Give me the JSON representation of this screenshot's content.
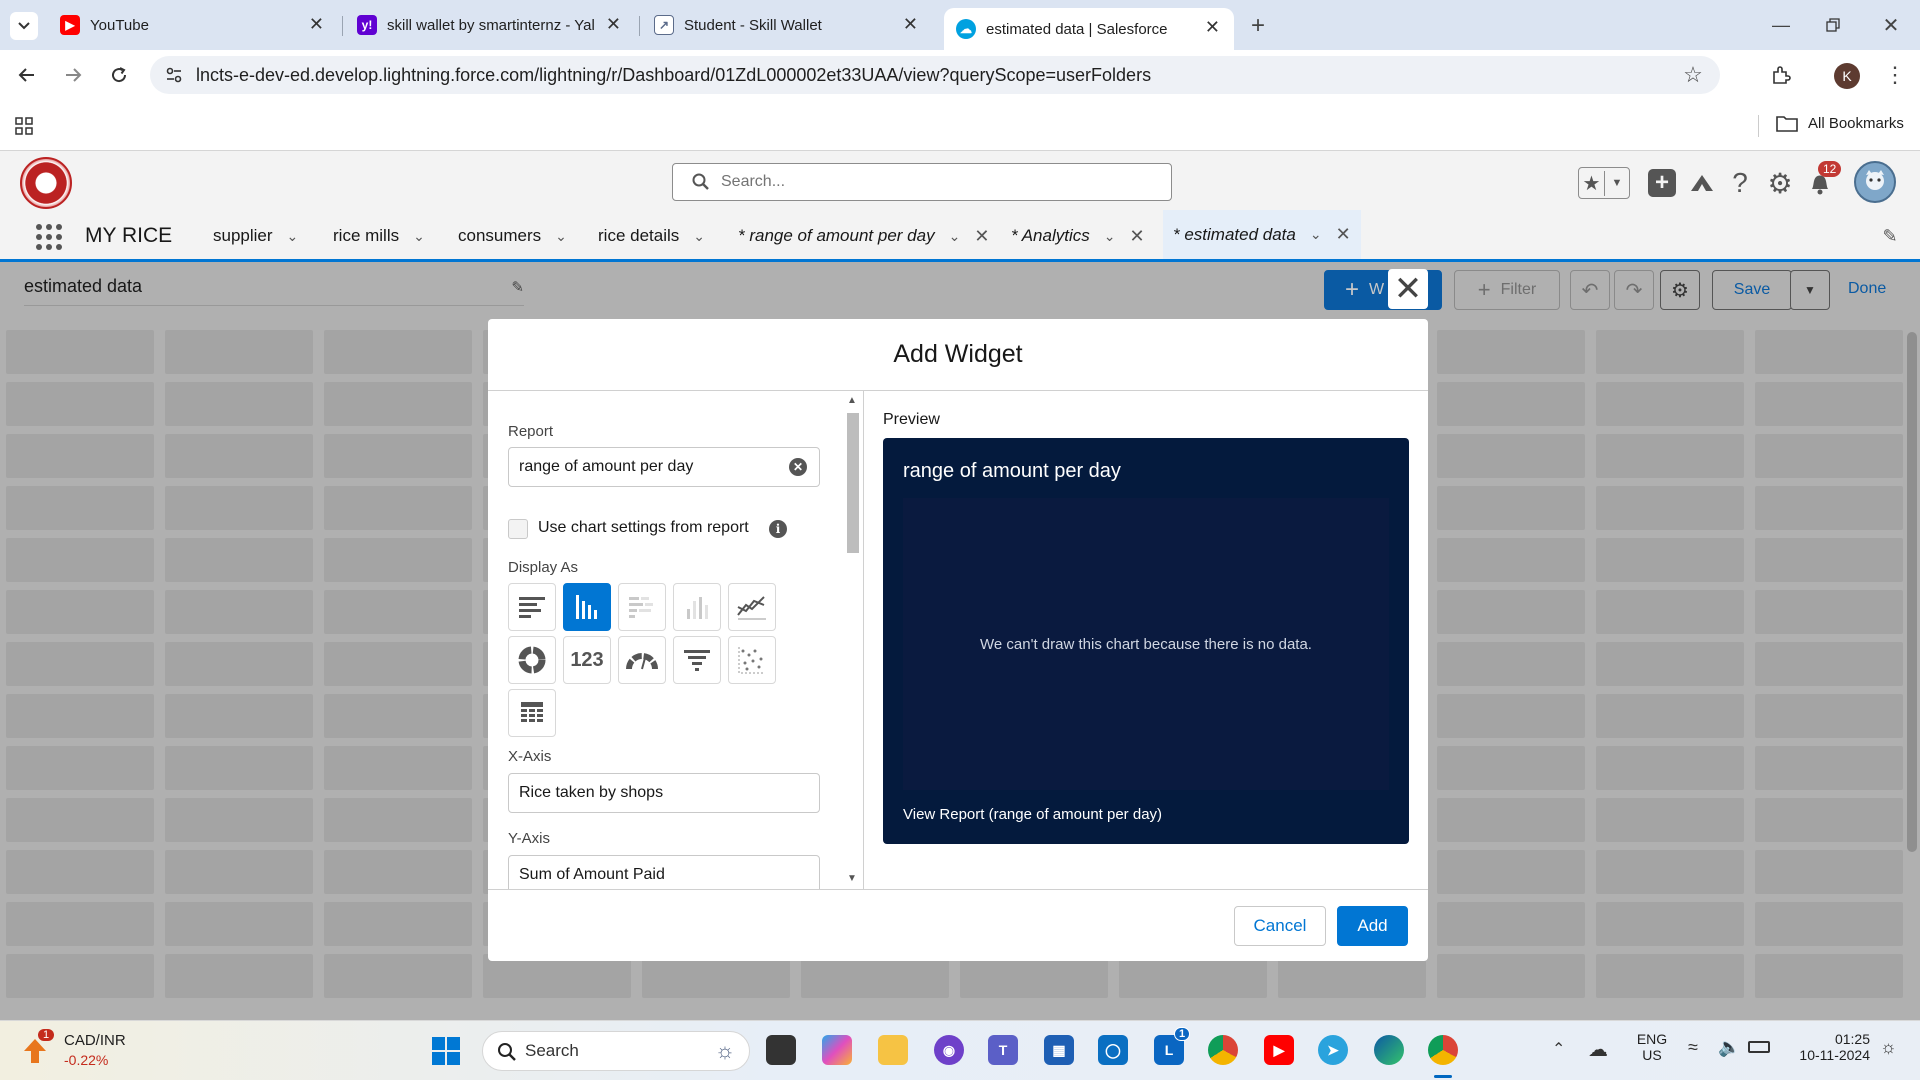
{
  "browser": {
    "tabs": [
      {
        "title": "YouTube",
        "icon": "youtube-icon",
        "color": "#ff0000"
      },
      {
        "title": "skill wallet by smartinternz - Yal",
        "icon": "yahoo-icon",
        "color": "#6001d2"
      },
      {
        "title": "Student - Skill Wallet",
        "icon": "skill-wallet-icon",
        "color": "#5b6b8a"
      },
      {
        "title": "estimated data | Salesforce",
        "icon": "salesforce-icon",
        "color": "#00a1e0"
      }
    ],
    "url": "lncts-e-dev-ed.develop.lightning.force.com/lightning/r/Dashboard/01ZdL000002et33UAA/view?queryScope=userFolders",
    "profile_initial": "K",
    "all_bookmarks": "All Bookmarks"
  },
  "salesforce": {
    "search_placeholder": "Search...",
    "notification_count": "12",
    "app_name": "MY RICE",
    "nav": [
      {
        "label": "supplier"
      },
      {
        "label": "rice mills"
      },
      {
        "label": "consumers"
      },
      {
        "label": "rice details"
      },
      {
        "label": "* range of amount per day"
      },
      {
        "label": "* Analytics"
      },
      {
        "label": "* estimated data"
      }
    ]
  },
  "dashboard": {
    "title": "estimated data",
    "widget_button": "W",
    "filter_button": "Filter",
    "save_button": "Save",
    "done_button": "Done"
  },
  "modal": {
    "title": "Add Widget",
    "report_label": "Report",
    "report_value": "range of amount per day",
    "use_chart_settings": "Use chart settings from report",
    "display_as_label": "Display As",
    "x_axis_label": "X-Axis",
    "x_axis_value": "Rice taken by shops",
    "y_axis_label": "Y-Axis",
    "y_axis_value": "Sum of Amount Paid",
    "preview_label": "Preview",
    "preview_title": "range of amount per day",
    "preview_empty": "We can't draw this chart because there is no data.",
    "preview_link": "View Report (range of amount per day)",
    "cancel": "Cancel",
    "add": "Add",
    "chart_types": [
      {
        "name": "horizontal-bar-chart-icon",
        "selected": false
      },
      {
        "name": "vertical-column-chart-icon",
        "selected": true
      },
      {
        "name": "stacked-bar-chart-icon",
        "selected": false
      },
      {
        "name": "stacked-column-chart-icon",
        "selected": false
      },
      {
        "name": "line-chart-icon",
        "selected": false
      },
      {
        "name": "donut-chart-icon",
        "selected": false
      },
      {
        "name": "metric-icon",
        "selected": false,
        "text": "123"
      },
      {
        "name": "gauge-chart-icon",
        "selected": false
      },
      {
        "name": "funnel-chart-icon",
        "selected": false
      },
      {
        "name": "scatter-chart-icon",
        "selected": false
      },
      {
        "name": "table-icon",
        "selected": false
      }
    ]
  },
  "taskbar": {
    "stock_badge": "1",
    "stock_name": "CAD/INR",
    "stock_change": "-0.22%",
    "search_label": "Search",
    "lang_top": "ENG",
    "lang_bottom": "US",
    "time": "01:25",
    "date": "10-11-2024",
    "linkedin_badge": "1"
  }
}
